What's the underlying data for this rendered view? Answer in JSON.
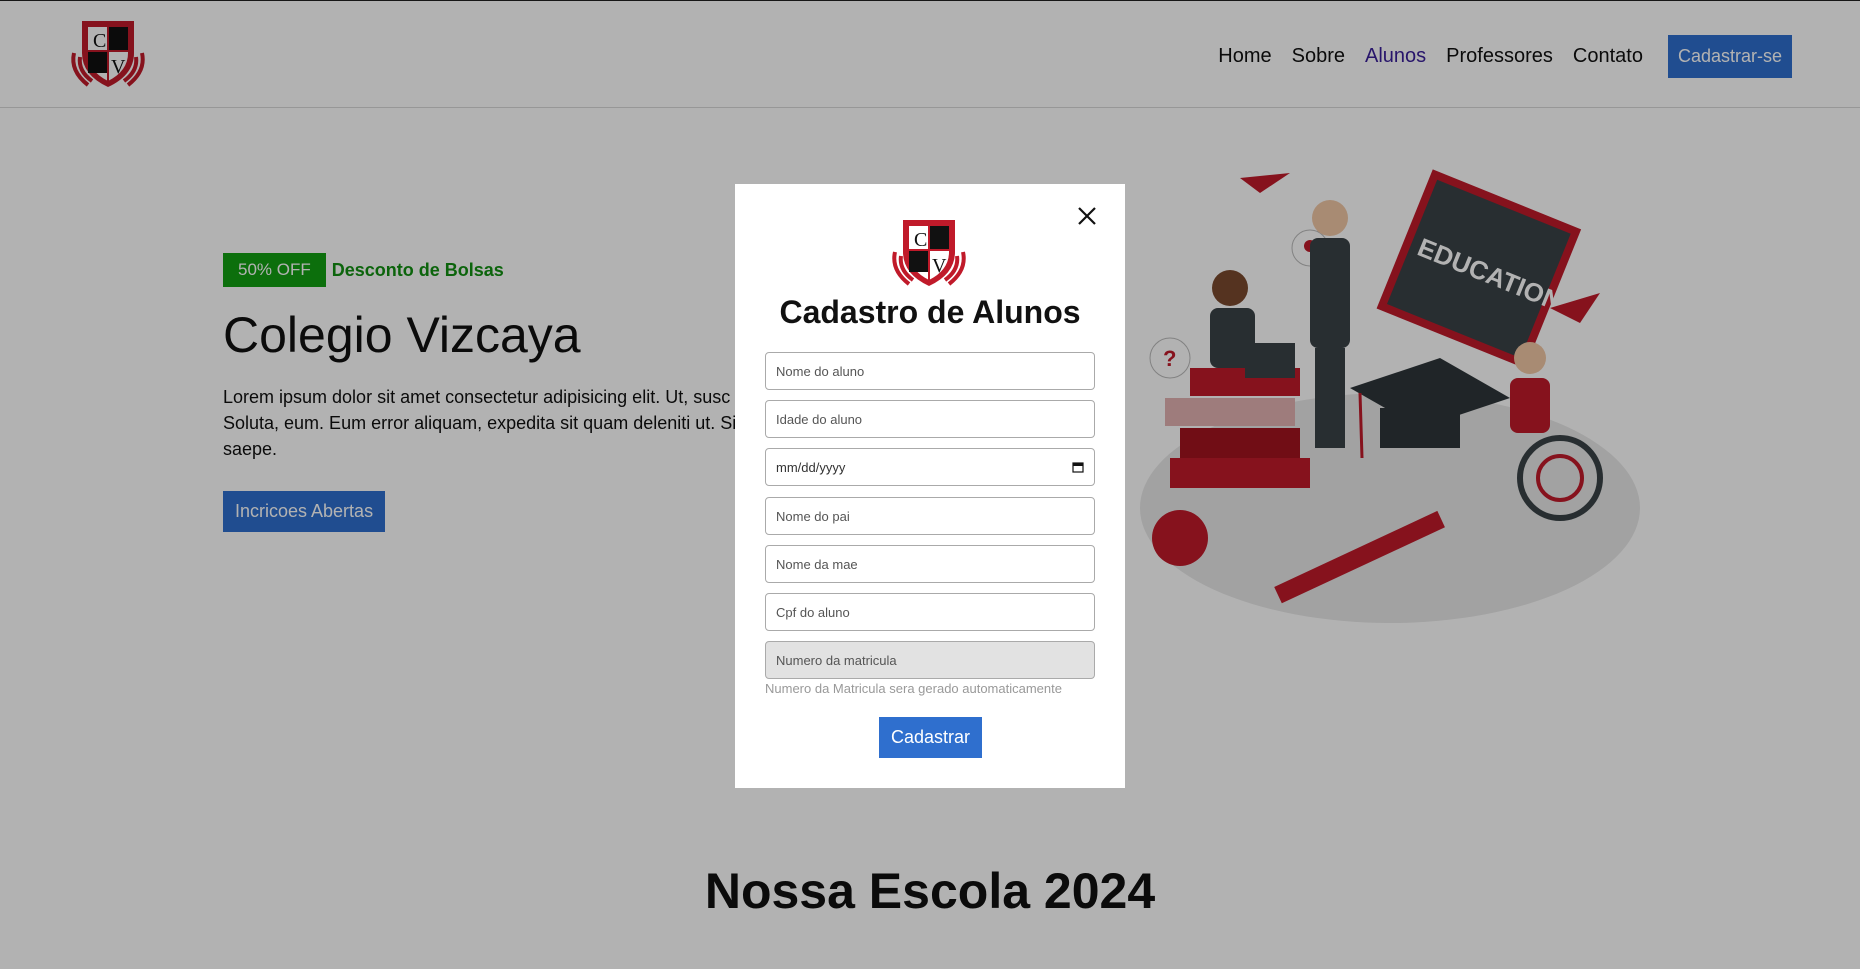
{
  "header": {
    "logo_letters": [
      "C",
      "V"
    ],
    "nav": [
      {
        "label": "Home"
      },
      {
        "label": "Sobre"
      },
      {
        "label": "Alunos"
      },
      {
        "label": "Professores"
      },
      {
        "label": "Contato"
      }
    ],
    "signup_label": "Cadastrar-se"
  },
  "hero": {
    "badge": "50% OFF",
    "badge_text": "Desconto de Bolsas",
    "title": "Colegio Vizcaya",
    "text": "Lorem ipsum dolor sit amet consectetur adipisicing elit. Ut, susc\nSoluta, eum. Eum error aliquam, expedita sit quam deleniti ut. Si\nsaepe.",
    "button": "Incricoes Abertas",
    "illustration_text": "EDUCATION"
  },
  "section": {
    "title": "Nossa Escola 2024"
  },
  "modal": {
    "title": "Cadastro de Alunos",
    "fields": {
      "nome_aluno": "Nome do aluno",
      "idade": "Idade do aluno",
      "data": "mm/dd/yyyy",
      "nome_pai": "Nome do pai",
      "nome_mae": "Nome da mae",
      "cpf": "Cpf do aluno",
      "matricula": "Numero da matricula"
    },
    "hint": "Numero da Matricula sera gerado automaticamente",
    "submit": "Cadastrar"
  },
  "colors": {
    "primary": "#2f6fce",
    "badge_green": "#12a012",
    "nav_active": "#3a1f9a",
    "brand_red": "#c01a2a"
  }
}
